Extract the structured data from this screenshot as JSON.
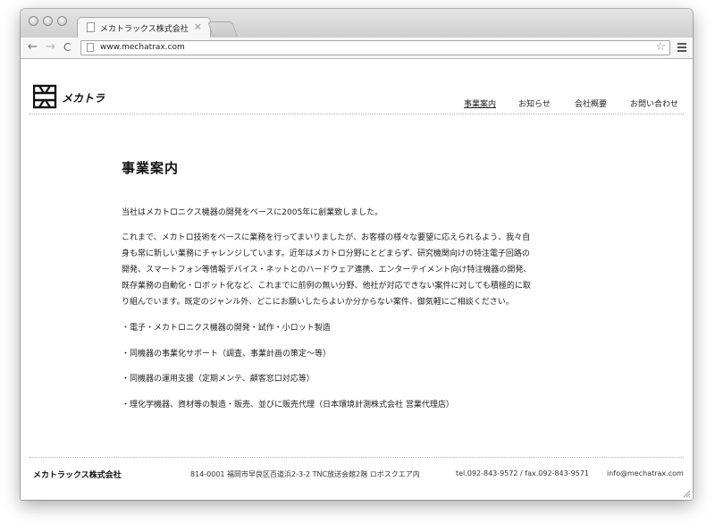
{
  "browser": {
    "tab_title": "メカトラックス株式会社",
    "tab_close": "×",
    "url": "www.mechatrax.com",
    "back_icon": "←",
    "forward_icon": "→",
    "reload_icon": "C",
    "star_icon": "☆"
  },
  "site": {
    "logo_text": "メカトラ",
    "nav": [
      {
        "label": "事業案内"
      },
      {
        "label": "お知らせ"
      },
      {
        "label": "会社概要"
      },
      {
        "label": "お問い合わせ"
      }
    ]
  },
  "content": {
    "title": "事業案内",
    "intro": "当社はメカトロニクス機器の開発をベースに2005年に創業致しました。",
    "body_lines": [
      "これまで、メカトロ技術をベースに業務を行ってまいりましたが、お客様の様々な要望に応えられるよう、我々自",
      "身も常に新しい業務にチャレンジしています。近年はメカトロ分野にとどまらず、研究機関向けの特注電子回路の",
      "開発、スマートフォン等情報デバイス・ネットとのハードウェア連携、エンターテイメント向け特注機器の開発、",
      "既存業務の自動化・ロボット化など、これまでに前例の無い分野、他社が対応できない案件に対しても積極的に取",
      "り組んでいます。既定のジャンル外、どこにお願いしたらよいか分からない案件、御気軽にご相談ください。"
    ],
    "bullets": [
      "・電子・メカトロニクス機器の開発・試作・小ロット製造",
      "・同機器の事業化サポート（調査、事業計画の策定〜等）",
      "・同機器の運用支援（定期メンテ、顧客窓口対応等）",
      "・理化学機器、資材等の製造・販売、並びに販売代理（日本環境計測株式会社 営業代理店）"
    ]
  },
  "footer": {
    "company": "メカトラックス株式会社",
    "address": "814-0001 福岡市早良区百道浜2-3-2 TNC放送会館2階 ロボスクエア内",
    "phone": "tel.092-843-9572 / fax.092-843-9571",
    "email": "info@mechatrax.com"
  }
}
